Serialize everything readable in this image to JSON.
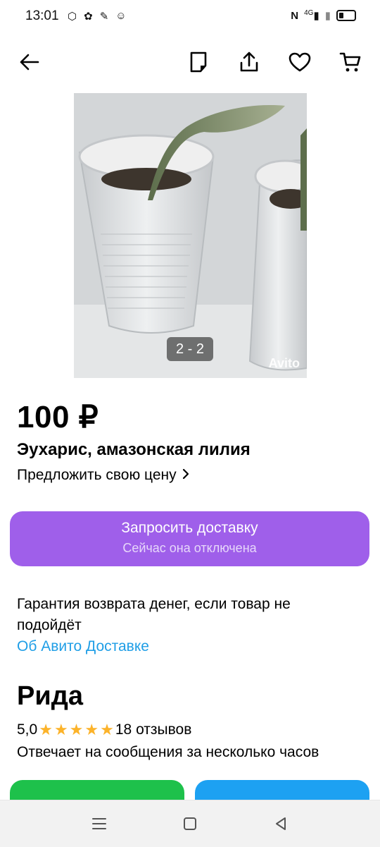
{
  "status_bar": {
    "time": "13:01",
    "left_icons": [
      "cube-icon",
      "flower-icon",
      "pencil-icon",
      "ok-icon"
    ],
    "right_icons": [
      "nfc-icon",
      "signal-4g-icon",
      "signal-icon",
      "battery-icon"
    ],
    "network": "4G"
  },
  "toolbar": {
    "icons": [
      "back-arrow-icon",
      "note-icon",
      "share-icon",
      "heart-icon",
      "cart-icon"
    ]
  },
  "gallery": {
    "counter": "2 - 2",
    "watermark": "Avito"
  },
  "listing": {
    "price": "100 ₽",
    "title": "Эухарис, амазонская лилия",
    "offer_price_label": "Предложить свою цену"
  },
  "delivery": {
    "button_label": "Запросить доставку",
    "button_sublabel": "Сейчас она отключена",
    "guarantee_text": "Гарантия возврата денег, если товар не подойдёт",
    "about_link": "Об Авито Доставке"
  },
  "seller": {
    "name": "Рида",
    "rating": "5,0",
    "stars": 5,
    "reviews": "18 отзывов",
    "response_time": "Отвечает на сообщения за несколько часов"
  },
  "colors": {
    "delivery_button": "#9f5fea",
    "link": "#1f9ee6",
    "star": "#fcb32a",
    "call_button": "#1ec14b",
    "message_button": "#1da1f2"
  }
}
